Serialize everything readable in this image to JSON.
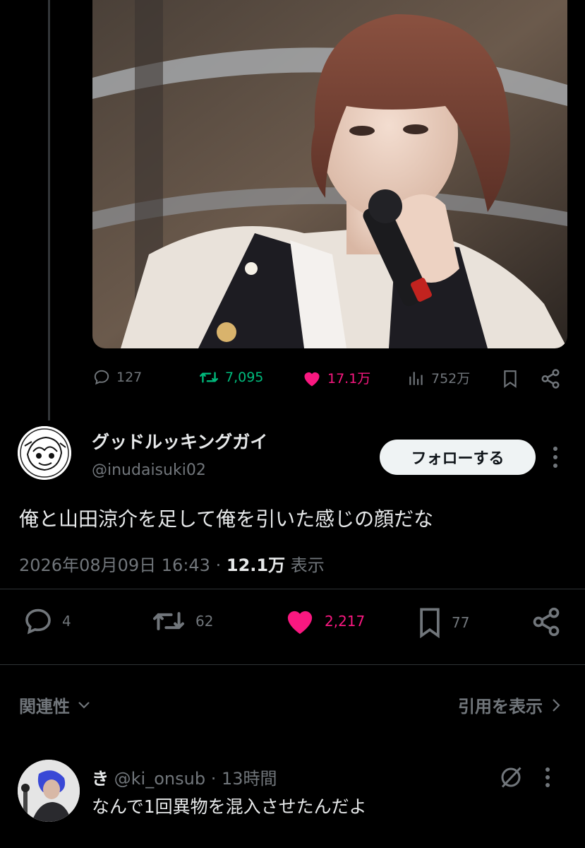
{
  "quoted_post": {
    "stats": {
      "replies": "127",
      "reposts": "7,095",
      "likes": "17.1万",
      "views": "752万"
    }
  },
  "post": {
    "author_name": "グッドルッキングガイ",
    "author_handle": "@inudaisuki02",
    "follow_label": "フォローする",
    "text": "俺と山田涼介を足して俺を引いた感じの顔だな",
    "date": "2026年08月09日 16:43",
    "separator": "·",
    "views_count": "12.1万",
    "views_label": "表示",
    "actions": {
      "replies": "4",
      "reposts": "62",
      "likes": "2,217",
      "bookmarks": "77"
    }
  },
  "tabs": {
    "sort_label": "関連性",
    "quotes_label": "引用を表示"
  },
  "reply": {
    "author_name": "き",
    "author_handle": "@ki_onsub",
    "separator": "·",
    "time": "13時間",
    "text": "なんで1回異物を混入させたんだよ"
  },
  "colors": {
    "background": "#000000",
    "like_pink": "#f91880",
    "repost_green": "#00ba7c",
    "muted": "#71767b"
  }
}
